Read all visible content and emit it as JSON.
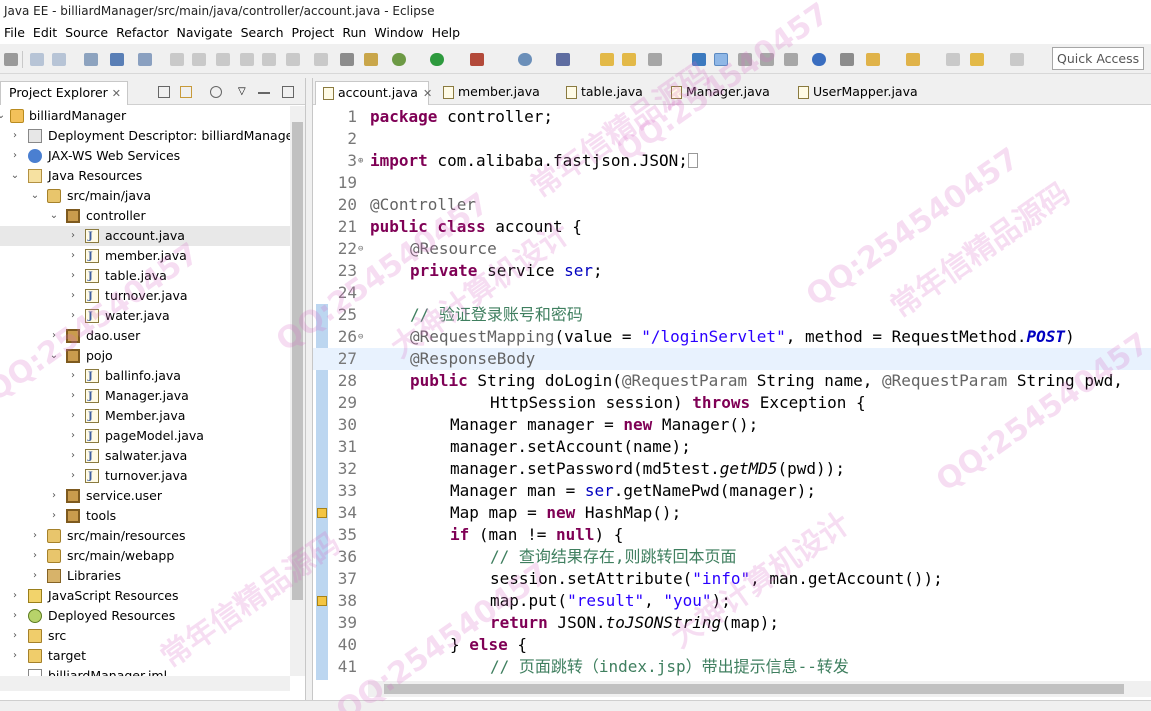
{
  "window": {
    "title": "Java EE - billiardManager/src/main/java/controller/account.java - Eclipse"
  },
  "menu": [
    "File",
    "Edit",
    "Source",
    "Refactor",
    "Navigate",
    "Search",
    "Project",
    "Run",
    "Window",
    "Help"
  ],
  "toolbar": {
    "quick_access": "Quick Access"
  },
  "explorer": {
    "tab_label": "Project Explorer",
    "tree": [
      {
        "label": "billiardManager"
      },
      {
        "label": "Deployment Descriptor: billiardManager"
      },
      {
        "label": "JAX-WS Web Services"
      },
      {
        "label": "Java Resources"
      },
      {
        "label": "src/main/java"
      },
      {
        "label": "controller"
      },
      {
        "label": "account.java"
      },
      {
        "label": "member.java"
      },
      {
        "label": "table.java"
      },
      {
        "label": "turnover.java"
      },
      {
        "label": "water.java"
      },
      {
        "label": "dao.user"
      },
      {
        "label": "pojo"
      },
      {
        "label": "ballinfo.java"
      },
      {
        "label": "Manager.java"
      },
      {
        "label": "Member.java"
      },
      {
        "label": "pageModel.java"
      },
      {
        "label": "salwater.java"
      },
      {
        "label": "turnover.java"
      },
      {
        "label": "service.user"
      },
      {
        "label": "tools"
      },
      {
        "label": "src/main/resources"
      },
      {
        "label": "src/main/webapp"
      },
      {
        "label": "Libraries"
      },
      {
        "label": "JavaScript Resources"
      },
      {
        "label": "Deployed Resources"
      },
      {
        "label": "src"
      },
      {
        "label": "target"
      },
      {
        "label": "billiardManager.iml"
      }
    ]
  },
  "editor": {
    "tabs": [
      "account.java",
      "member.java",
      "table.java",
      "Manager.java",
      "UserMapper.java"
    ],
    "line_numbers": [
      "1",
      "2",
      "3",
      "19",
      "20",
      "21",
      "22",
      "23",
      "24",
      "25",
      "26",
      "27",
      "28",
      "29",
      "30",
      "31",
      "32",
      "33",
      "34",
      "35",
      "36",
      "37",
      "38",
      "39",
      "40",
      "41"
    ],
    "code": {
      "l1_kw": "package",
      "l1_rest": " controller;",
      "l3_kw": "import",
      "l3_rest": " com.alibaba.fastjson.JSON;",
      "l20": "@Controller",
      "l21_kw": "public class",
      "l21_rest": " account {",
      "l22": "@Resource",
      "l23_kw": "private",
      "l23_type": " service ",
      "l23_fld": "ser",
      "l23_end": ";",
      "l25": "// 验证登录账号和密码",
      "l26_an": "@RequestMapping",
      "l26_a": "(value = ",
      "l26_str": "\"/loginServlet\"",
      "l26_b": ", method = RequestMethod.",
      "l26_post": "POST",
      "l26_c": ")",
      "l27": "@ResponseBody",
      "l28_kw": "public",
      "l28_a": " String doLogin(",
      "l28_an1": "@RequestParam",
      "l28_b": " String name, ",
      "l28_an2": "@RequestParam",
      "l28_c": " String pwd,",
      "l29_a": "HttpSession session) ",
      "l29_kw": "throws",
      "l29_b": " Exception {",
      "l30_a": "Manager manager = ",
      "l30_kw": "new",
      "l30_b": " Manager();",
      "l31": "manager.setAccount(name);",
      "l32_a": "manager.setPassword(md5test.",
      "l32_it": "getMD5",
      "l32_b": "(pwd));",
      "l33_a": "Manager man = ",
      "l33_fld": "ser",
      "l33_b": ".getNamePwd(manager);",
      "l34_a": "Map map = ",
      "l34_kw": "new",
      "l34_b": " HashMap();",
      "l35_kw": "if",
      "l35_a": " (man != ",
      "l35_kw2": "null",
      "l35_b": ") {",
      "l36": "// 查询结果存在,则跳转回本页面",
      "l37_a": "session.setAttribute(",
      "l37_str": "\"info\"",
      "l37_b": ", man.getAccount());",
      "l38_a": "map.put(",
      "l38_str1": "\"result\"",
      "l38_b": ", ",
      "l38_str2": "\"you\"",
      "l38_c": ");",
      "l39_kw": "return",
      "l39_a": " JSON.",
      "l39_it": "toJSONString",
      "l39_b": "(map);",
      "l40_a": "} ",
      "l40_kw": "else",
      "l40_b": " {",
      "l41": "// 页面跳转（index.jsp）带出提示信息--转发"
    }
  },
  "watermark": [
    "QQ:254540457",
    "大神计算机设计",
    "常年信精品源码"
  ],
  "colors": {
    "keyword": "#7f0055",
    "string": "#2a00ff",
    "comment": "#3f7f5f",
    "annotation": "#646464",
    "field": "#0000c0",
    "watermark": "#d76ec8"
  }
}
